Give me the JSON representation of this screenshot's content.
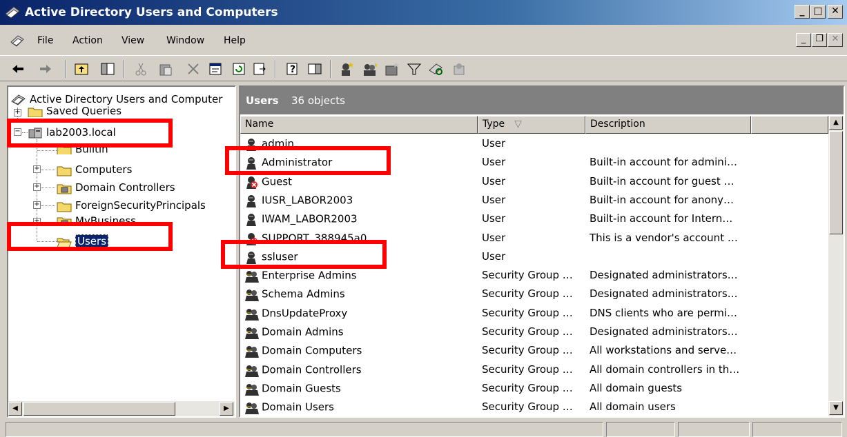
{
  "window": {
    "title": "Active Directory Users and Computers"
  },
  "menu": {
    "file": "File",
    "action": "Action",
    "view": "View",
    "window": "Window",
    "help": "Help"
  },
  "window_buttons": {
    "minimize": "_",
    "maximize": "□",
    "close": "✕"
  },
  "tree": {
    "root": "Active Directory Users and Computer",
    "items": [
      {
        "label": "Saved Queries",
        "icon": "folder-icon"
      },
      {
        "label": "lab2003.local",
        "icon": "domain-icon"
      },
      {
        "label": "Builtin",
        "icon": "folder-icon"
      },
      {
        "label": "Computers",
        "icon": "folder-icon"
      },
      {
        "label": "Domain Controllers",
        "icon": "ou-icon"
      },
      {
        "label": "ForeignSecurityPrincipals",
        "icon": "folder-icon"
      },
      {
        "label": "MyBusiness",
        "icon": "ou-icon"
      },
      {
        "label": "Users",
        "icon": "folder-open-icon"
      }
    ]
  },
  "list": {
    "title": "Users",
    "count": "36 objects",
    "columns": {
      "name": "Name",
      "type": "Type",
      "description": "Description"
    },
    "rows": [
      {
        "name": "admin",
        "type": "User",
        "description": "",
        "icon": "user-icon"
      },
      {
        "name": "Administrator",
        "type": "User",
        "description": "Built-in account for admini…",
        "icon": "user-icon"
      },
      {
        "name": "Guest",
        "type": "User",
        "description": "Built-in account for guest …",
        "icon": "user-disabled-icon"
      },
      {
        "name": "IUSR_LABOR2003",
        "type": "User",
        "description": "Built-in account for anony…",
        "icon": "user-icon"
      },
      {
        "name": "IWAM_LABOR2003",
        "type": "User",
        "description": "Built-in account for Intern…",
        "icon": "user-icon"
      },
      {
        "name": "SUPPORT_388945a0",
        "type": "User",
        "description": "This is a vendor's account …",
        "icon": "user-disabled-icon"
      },
      {
        "name": "ssluser",
        "type": "User",
        "description": "",
        "icon": "user-icon"
      },
      {
        "name": "Enterprise Admins",
        "type": "Security Group …",
        "description": "Designated administrators…",
        "icon": "group-icon"
      },
      {
        "name": "Schema Admins",
        "type": "Security Group …",
        "description": "Designated administrators…",
        "icon": "group-icon"
      },
      {
        "name": "DnsUpdateProxy",
        "type": "Security Group …",
        "description": "DNS clients who are permi…",
        "icon": "group-icon"
      },
      {
        "name": "Domain Admins",
        "type": "Security Group …",
        "description": "Designated administrators…",
        "icon": "group-icon"
      },
      {
        "name": "Domain Computers",
        "type": "Security Group …",
        "description": "All workstations and serve…",
        "icon": "group-icon"
      },
      {
        "name": "Domain Controllers",
        "type": "Security Group …",
        "description": "All domain controllers in th…",
        "icon": "group-icon"
      },
      {
        "name": "Domain Guests",
        "type": "Security Group …",
        "description": "All domain guests",
        "icon": "group-icon"
      },
      {
        "name": "Domain Users",
        "type": "Security Group …",
        "description": "All domain users",
        "icon": "group-icon"
      }
    ]
  },
  "highlight_color": "#ff0000",
  "accent_color": "#0a246a"
}
